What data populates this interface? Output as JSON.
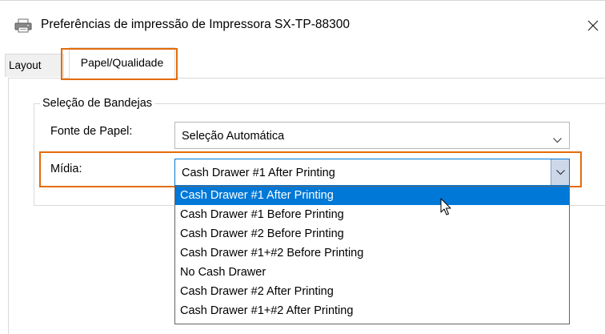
{
  "window": {
    "title": "Preferências de impressão de Impressora SX-TP-88300"
  },
  "icons": {
    "title": "printer-icon",
    "close": "close-icon",
    "dropdown": "chevron-down-icon",
    "pointer": "mouse-pointer-icon"
  },
  "tabs": [
    {
      "label": "Layout",
      "selected": false
    },
    {
      "label": "Papel/Qualidade",
      "selected": true
    }
  ],
  "tray_group": {
    "title": "Seleção de Bandejas",
    "paper_source": {
      "label": "Fonte de Papel:",
      "value": "Seleção Automática"
    },
    "media": {
      "label": "Mídia:",
      "value": "Cash Drawer #1 After Printing",
      "options": [
        "Cash Drawer #1 After Printing",
        "Cash Drawer #1 Before Printing",
        "Cash Drawer #2 Before Printing",
        "Cash Drawer #1+#2 Before Printing",
        "No Cash Drawer",
        "Cash Drawer #2 After Printing",
        "Cash Drawer #1+#2 After Printing"
      ],
      "highlighted_option": "Cash Drawer #1 After Printing"
    }
  },
  "colors": {
    "highlight_box": "#e36c0a",
    "selection": "#0078d7",
    "dropdown_button": "#ccd8ea"
  }
}
